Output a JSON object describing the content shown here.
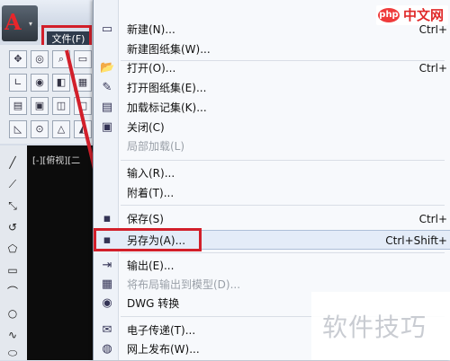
{
  "file_tab": {
    "label": "文件(F)"
  },
  "app_button": {
    "logo": "A",
    "arrow": "▾"
  },
  "viewport": {
    "label": "[-][俯视][二"
  },
  "menu": {
    "items": [
      {
        "label": "新建(N)...",
        "shortcut": "Ctrl+",
        "icon": "new-file-icon",
        "glyph": "▭"
      },
      {
        "label": "新建图纸集(W)...",
        "shortcut": "",
        "icon": "",
        "glyph": ""
      },
      {
        "label": "打开(O)...",
        "shortcut": "Ctrl+",
        "icon": "open-folder-icon",
        "glyph": "📂"
      },
      {
        "label": "打开图纸集(E)...",
        "shortcut": "",
        "icon": "sheet-set-icon",
        "glyph": "✎"
      },
      {
        "label": "加载标记集(K)...",
        "shortcut": "",
        "icon": "markup-icon",
        "glyph": "▤"
      },
      {
        "label": "关闭(C)",
        "shortcut": "",
        "icon": "close-file-icon",
        "glyph": "▣"
      },
      {
        "label": "局部加载(L)",
        "shortcut": "",
        "icon": "",
        "glyph": "",
        "disabled": true
      },
      {
        "label": "输入(R)...",
        "shortcut": "",
        "icon": "",
        "glyph": ""
      },
      {
        "label": "附着(T)...",
        "shortcut": "",
        "icon": "",
        "glyph": ""
      },
      {
        "label": "保存(S)",
        "shortcut": "Ctrl+",
        "icon": "save-icon",
        "glyph": "▪"
      },
      {
        "label": "另存为(A)...",
        "shortcut": "Ctrl+Shift+",
        "icon": "save-as-icon",
        "glyph": "▪",
        "highlight": true
      },
      {
        "label": "输出(E)...",
        "shortcut": "",
        "icon": "export-icon",
        "glyph": "⇥"
      },
      {
        "label": "将布局输出到模型(D)...",
        "shortcut": "",
        "icon": "layout-export-icon",
        "glyph": "▦",
        "disabled": true
      },
      {
        "label": "DWG 转换",
        "shortcut": "",
        "icon": "dwg-convert-icon",
        "glyph": "◉"
      },
      {
        "label": "电子传递(T)...",
        "shortcut": "",
        "icon": "etransmit-icon",
        "glyph": "✉"
      },
      {
        "label": "网上发布(W)...",
        "shortcut": "",
        "icon": "web-publish-icon",
        "glyph": "◍"
      }
    ]
  },
  "watermarks": {
    "php_badge": "php",
    "php_text": "中文网",
    "tips": "软件技巧"
  },
  "colors": {
    "highlight_red": "#d21f2a",
    "menu_bg": "#f7f9fc"
  }
}
